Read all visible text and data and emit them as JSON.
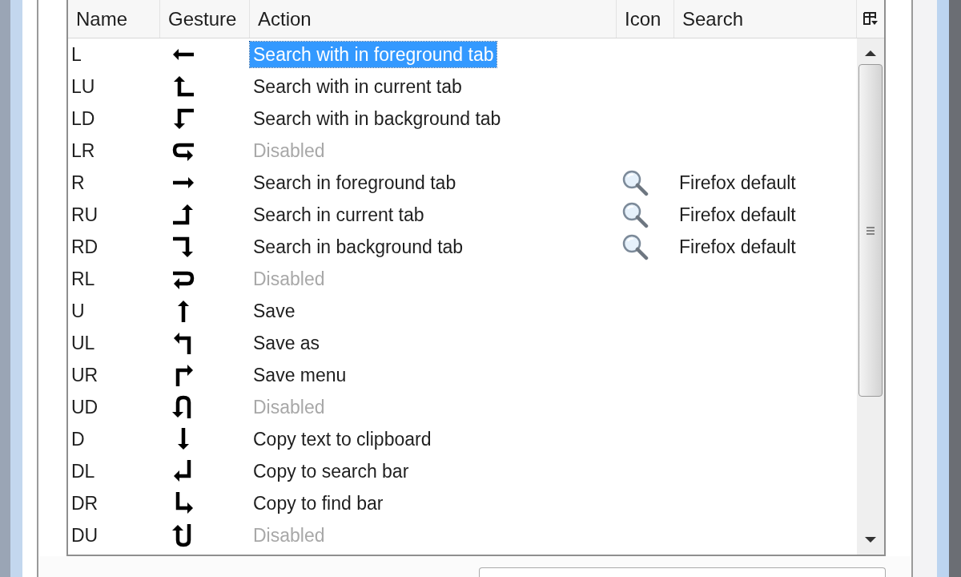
{
  "table": {
    "columns": [
      "Name",
      "Gesture",
      "Action",
      "Icon",
      "Search"
    ],
    "rows": [
      {
        "name": "L",
        "kind": "left",
        "action": "Search with in foreground tab",
        "selected": true,
        "disabled": false
      },
      {
        "name": "LU",
        "kind": "left-up",
        "action": "Search with in current tab",
        "selected": false,
        "disabled": false
      },
      {
        "name": "LD",
        "kind": "left-down",
        "action": "Search with in background tab",
        "selected": false,
        "disabled": false
      },
      {
        "name": "LR",
        "kind": "left-right",
        "action": "Disabled",
        "selected": false,
        "disabled": true
      },
      {
        "name": "R",
        "kind": "right",
        "action": "Search in foreground tab",
        "selected": false,
        "disabled": false,
        "search": "Firefox default"
      },
      {
        "name": "RU",
        "kind": "right-up",
        "action": "Search in current tab",
        "selected": false,
        "disabled": false,
        "search": "Firefox default"
      },
      {
        "name": "RD",
        "kind": "right-down",
        "action": "Search in background tab",
        "selected": false,
        "disabled": false,
        "search": "Firefox default"
      },
      {
        "name": "RL",
        "kind": "right-left",
        "action": "Disabled",
        "selected": false,
        "disabled": true
      },
      {
        "name": "U",
        "kind": "up",
        "action": "Save",
        "selected": false,
        "disabled": false
      },
      {
        "name": "UL",
        "kind": "up-left",
        "action": "Save as",
        "selected": false,
        "disabled": false
      },
      {
        "name": "UR",
        "kind": "up-right",
        "action": "Save menu",
        "selected": false,
        "disabled": false
      },
      {
        "name": "UD",
        "kind": "up-down",
        "action": "Disabled",
        "selected": false,
        "disabled": true
      },
      {
        "name": "D",
        "kind": "down",
        "action": "Copy text to clipboard",
        "selected": false,
        "disabled": false
      },
      {
        "name": "DL",
        "kind": "down-left",
        "action": "Copy to search bar",
        "selected": false,
        "disabled": false
      },
      {
        "name": "DR",
        "kind": "down-right",
        "action": "Copy to find bar",
        "selected": false,
        "disabled": false
      },
      {
        "name": "DU",
        "kind": "down-up",
        "action": "Disabled",
        "selected": false,
        "disabled": true
      }
    ]
  }
}
